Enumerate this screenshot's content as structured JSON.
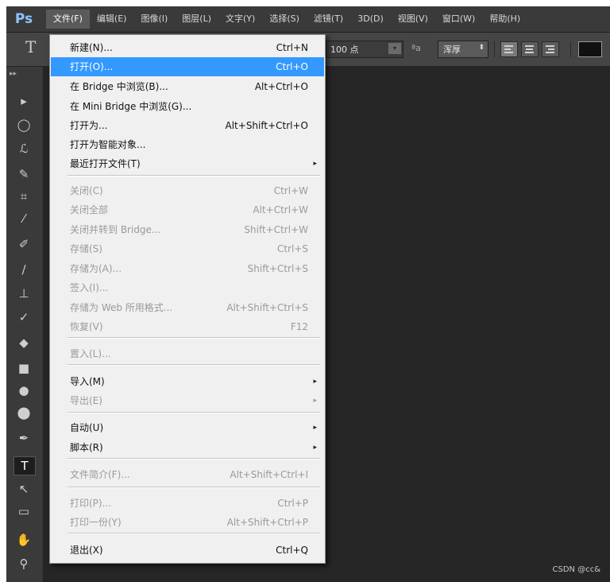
{
  "menubar": {
    "logo": "Ps",
    "items": [
      "文件(F)",
      "编辑(E)",
      "图像(I)",
      "图层(L)",
      "文字(Y)",
      "选择(S)",
      "滤镜(T)",
      "3D(D)",
      "视图(V)",
      "窗口(W)",
      "帮助(H)"
    ]
  },
  "options": {
    "tool_glyph": "T",
    "font_size": "100 点",
    "aa_icon": "ªa",
    "antialias": "浑厚"
  },
  "file_menu": [
    {
      "label": "新建(N)...",
      "shortcut": "Ctrl+N",
      "enabled": true
    },
    {
      "label": "打开(O)...",
      "shortcut": "Ctrl+O",
      "enabled": true,
      "highlighted": true
    },
    {
      "label": "在 Bridge 中浏览(B)...",
      "shortcut": "Alt+Ctrl+O",
      "enabled": true
    },
    {
      "label": "在 Mini Bridge 中浏览(G)...",
      "shortcut": "",
      "enabled": true
    },
    {
      "label": "打开为...",
      "shortcut": "Alt+Shift+Ctrl+O",
      "enabled": true
    },
    {
      "label": "打开为智能对象...",
      "shortcut": "",
      "enabled": true
    },
    {
      "label": "最近打开文件(T)",
      "shortcut": "",
      "enabled": true,
      "submenu": true
    },
    {
      "label": "关闭(C)",
      "shortcut": "Ctrl+W",
      "enabled": false
    },
    {
      "label": "关闭全部",
      "shortcut": "Alt+Ctrl+W",
      "enabled": false
    },
    {
      "label": "关闭并转到 Bridge...",
      "shortcut": "Shift+Ctrl+W",
      "enabled": false
    },
    {
      "label": "存储(S)",
      "shortcut": "Ctrl+S",
      "enabled": false
    },
    {
      "label": "存储为(A)...",
      "shortcut": "Shift+Ctrl+S",
      "enabled": false
    },
    {
      "label": "签入(I)...",
      "shortcut": "",
      "enabled": false
    },
    {
      "label": "存储为 Web 所用格式...",
      "shortcut": "Alt+Shift+Ctrl+S",
      "enabled": false
    },
    {
      "label": "恢复(V)",
      "shortcut": "F12",
      "enabled": false
    },
    {
      "label": "置入(L)...",
      "shortcut": "",
      "enabled": false
    },
    {
      "label": "导入(M)",
      "shortcut": "",
      "enabled": true,
      "submenu": true
    },
    {
      "label": "导出(E)",
      "shortcut": "",
      "enabled": false,
      "submenu": true
    },
    {
      "label": "自动(U)",
      "shortcut": "",
      "enabled": true,
      "submenu": true
    },
    {
      "label": "脚本(R)",
      "shortcut": "",
      "enabled": true,
      "submenu": true
    },
    {
      "label": "文件简介(F)...",
      "shortcut": "Alt+Shift+Ctrl+I",
      "enabled": false
    },
    {
      "label": "打印(P)...",
      "shortcut": "Ctrl+P",
      "enabled": false
    },
    {
      "label": "打印一份(Y)",
      "shortcut": "Alt+Shift+Ctrl+P",
      "enabled": false
    },
    {
      "label": "退出(X)",
      "shortcut": "Ctrl+Q",
      "enabled": true
    }
  ],
  "submenu_arrow": "▸",
  "tools": [
    {
      "name": "move-tool-icon",
      "glyph": "▸"
    },
    {
      "name": "marquee-tool-icon",
      "glyph": "◯"
    },
    {
      "name": "lasso-tool-icon",
      "glyph": "ℒ"
    },
    {
      "name": "quick-select-tool-icon",
      "glyph": "✎"
    },
    {
      "name": "crop-tool-icon",
      "glyph": "⌗"
    },
    {
      "name": "eyedropper-tool-icon",
      "glyph": "⁄"
    },
    {
      "name": "healing-brush-tool-icon",
      "glyph": "✐"
    },
    {
      "name": "brush-tool-icon",
      "glyph": "∕"
    },
    {
      "name": "clone-stamp-tool-icon",
      "glyph": "⊥"
    },
    {
      "name": "history-brush-tool-icon",
      "glyph": "✓"
    },
    {
      "name": "eraser-tool-icon",
      "glyph": "◆"
    },
    {
      "name": "gradient-tool-icon",
      "glyph": "■"
    },
    {
      "name": "blur-tool-icon",
      "glyph": "●"
    },
    {
      "name": "dodge-tool-icon",
      "glyph": "⬤"
    },
    {
      "name": "pen-tool-icon",
      "glyph": "✒"
    },
    {
      "name": "type-tool-icon",
      "glyph": "T"
    },
    {
      "name": "path-select-tool-icon",
      "glyph": "↖"
    },
    {
      "name": "shape-tool-icon",
      "glyph": "▭"
    },
    {
      "name": "hand-tool-icon",
      "glyph": "✋"
    },
    {
      "name": "zoom-tool-icon",
      "glyph": "⚲"
    }
  ],
  "watermark": "CSDN @cc&"
}
